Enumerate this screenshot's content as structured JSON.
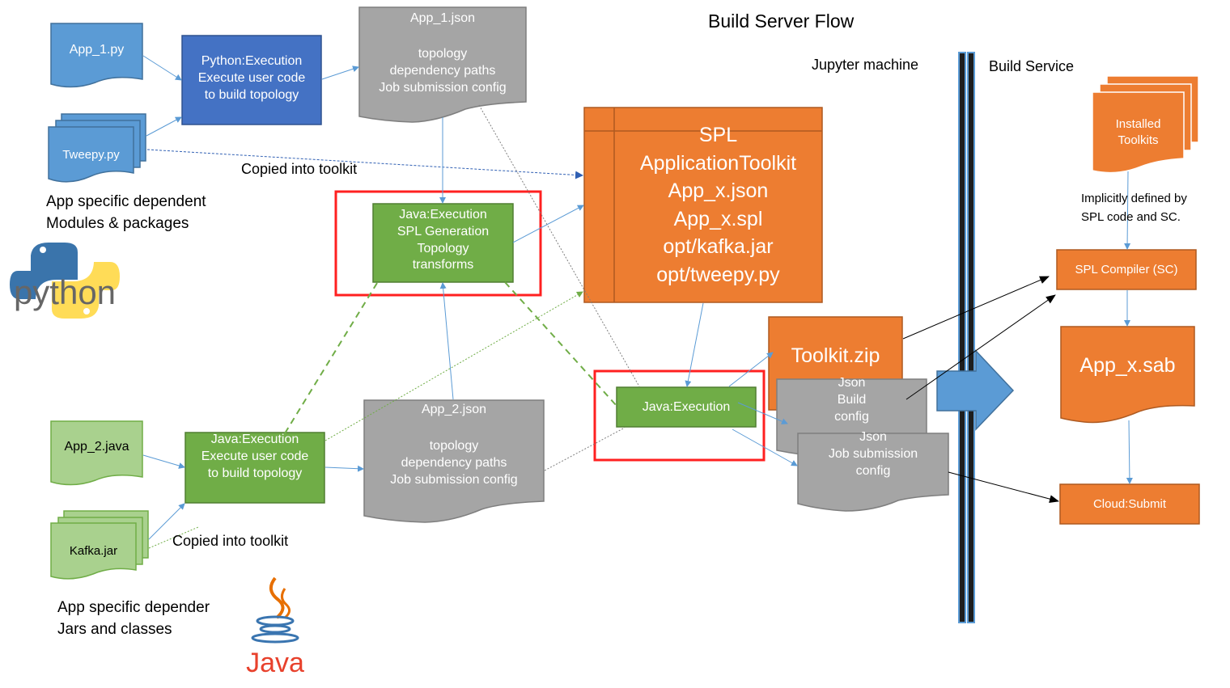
{
  "title": "Build Server Flow",
  "zones": {
    "left": "Jupyter machine",
    "right": "Build Service"
  },
  "python_section": {
    "app_file": "App_1.py",
    "dep_file": "Tweepy.py",
    "executor": "Python:Execution\nExecute user code\nto build topology",
    "output_json": {
      "title": "App_1.json",
      "body": "topology\ndependency paths\nJob submission config"
    },
    "copied_note": "Copied into toolkit",
    "deps_caption": "App specific dependent\nModules & packages",
    "logo": "python"
  },
  "java_section": {
    "app_file": "App_2.java",
    "dep_file": "Kafka.jar",
    "executor": "Java:Execution\nExecute user code\nto build topology",
    "output_json": {
      "title": "App_2.json",
      "body": "topology\ndependency paths\nJob submission config"
    },
    "copied_note": "Copied into toolkit",
    "deps_caption": "App specific depender\nJars and classes",
    "logo": "Java"
  },
  "spl_generation": "Java:Execution\nSPL Generation\nTopology\ntransforms",
  "toolkit_box": "SPL\nApplicationToolkit\nApp_x.json\nApp_x.spl\nopt/kafka.jar\nopt/tweepy.py",
  "java_execution": "Java:Execution",
  "toolkit_zip": "Toolkit.zip",
  "build_config": "Json\nBuild\nconfig",
  "job_config": "Json\nJob submission\nconfig",
  "build_service": {
    "installed_toolkits": "Installed\nToolkits",
    "implicit_note": "Implicitly defined by\nSPL code and SC.",
    "compiler": "SPL Compiler (SC)",
    "sab": "App_x.sab",
    "submit": "Cloud:Submit"
  },
  "colors": {
    "python_blue": "#5b9bd5",
    "python_exec": "#4472c4",
    "java_green": "#70ad47",
    "java_light": "#a9d18e",
    "json_gray": "#a5a5a5",
    "orange": "#ed7d31",
    "highlight_red": "#ff2020"
  }
}
